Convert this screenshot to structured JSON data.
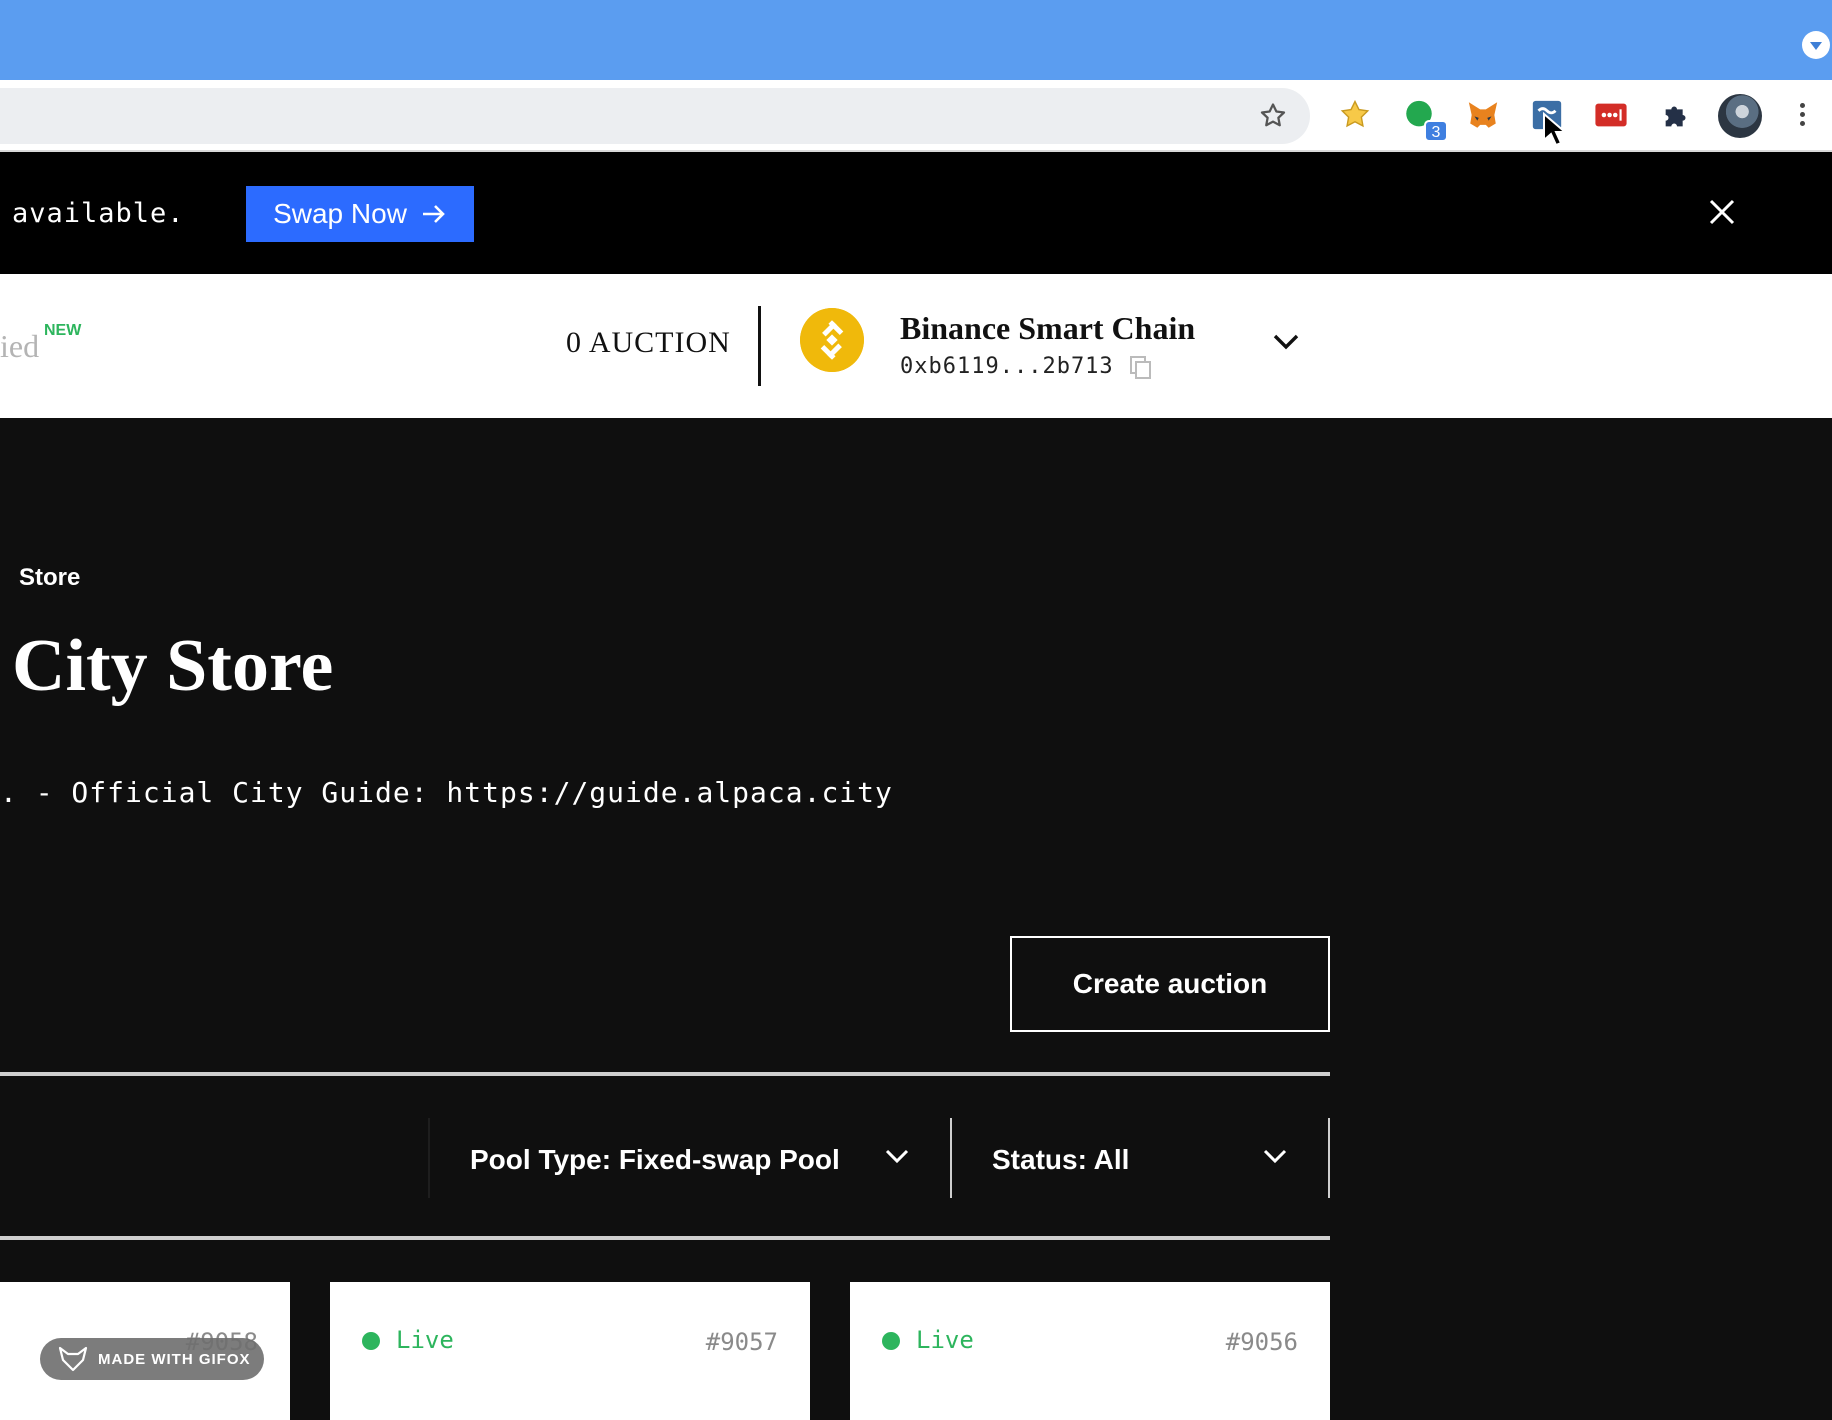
{
  "browser": {
    "extension_badge_count": "3"
  },
  "announcement": {
    "text": "available.",
    "swap_button_label": "Swap Now"
  },
  "header": {
    "nav_partial": "ied",
    "nav_new_badge": "NEW",
    "auction_count": "0 AUCTION",
    "chain_name": "Binance Smart Chain",
    "wallet_address": "0xb6119...2b713"
  },
  "main": {
    "breadcrumb": "Store",
    "title": "City Store",
    "description": ". - Official City Guide: https://guide.alpaca.city",
    "create_button_label": "Create auction"
  },
  "filters": {
    "pool_type_label": "Pool Type: Fixed-swap Pool",
    "status_label": "Status: All"
  },
  "cards": [
    {
      "id": "#9058",
      "status": ""
    },
    {
      "id": "#9057",
      "status": "Live"
    },
    {
      "id": "#9056",
      "status": "Live"
    }
  ],
  "watermark": "MADE WITH GIFOX",
  "colors": {
    "titlebar": "#5b9df0",
    "swap_button": "#2c6bff",
    "live_green": "#2db55d",
    "bnb_yellow": "#f0b90b",
    "page_bg": "#0f0f0f"
  },
  "icons": [
    "star-icon",
    "close-icon",
    "copy-icon",
    "chevron-down-icon",
    "binance-icon",
    "arrow-right-icon",
    "puzzle-icon"
  ]
}
